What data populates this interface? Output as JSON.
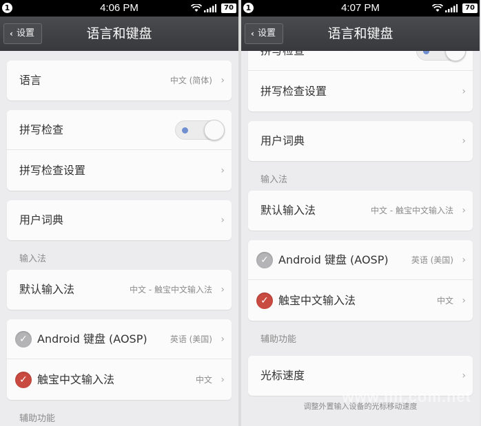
{
  "left": {
    "status": {
      "notif": "1",
      "time": "4:06 PM",
      "battery": "70"
    },
    "title": "语言和键盘",
    "back_label": "设置",
    "language": {
      "label": "语言",
      "value": "中文 (简体)"
    },
    "spell_check": {
      "label": "拼写检查",
      "on": true
    },
    "spell_settings": {
      "label": "拼写检查设置"
    },
    "user_dict": {
      "label": "用户词典"
    },
    "ime_header": "输入法",
    "default_ime": {
      "label": "默认输入法",
      "value": "中文 - 触宝中文输入法"
    },
    "aosp": {
      "label": "Android 键盘 (AOSP)",
      "value": "英语 (美国)",
      "checked": false
    },
    "chubao": {
      "label": "触宝中文输入法",
      "value": "中文",
      "checked": true
    },
    "accessibility_header": "辅助功能"
  },
  "right": {
    "status": {
      "notif": "1",
      "time": "4:07 PM",
      "battery": "70"
    },
    "title": "语言和键盘",
    "back_label": "设置",
    "spell_check": {
      "label": "拼写检查",
      "on": true
    },
    "spell_settings": {
      "label": "拼写检查设置"
    },
    "user_dict": {
      "label": "用户词典"
    },
    "ime_header": "输入法",
    "default_ime": {
      "label": "默认输入法",
      "value": "中文 - 触宝中文输入法"
    },
    "aosp": {
      "label": "Android 键盘 (AOSP)",
      "value": "英语 (美国)",
      "checked": false
    },
    "chubao": {
      "label": "触宝中文输入法",
      "value": "中文",
      "checked": true
    },
    "accessibility_header": "辅助功能",
    "cursor_speed": {
      "label": "光标速度"
    },
    "cursor_speed_note": "调整外置输入设备的光标移动速度",
    "watermark": "www.iiii.com.net"
  },
  "colors": {
    "toggle_dot": "#6f8fd0",
    "check_red": "#c94a40",
    "check_gray": "#b4b4b6",
    "titlebar": "#3e3f42"
  },
  "icons": [
    "notification-icon",
    "wifi-icon",
    "signal-icon",
    "battery-icon",
    "chevron-left-icon",
    "chevron-right-icon",
    "checkmark-icon"
  ]
}
